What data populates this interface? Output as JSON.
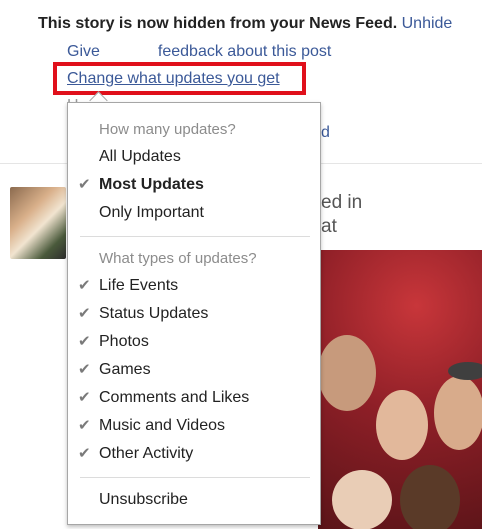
{
  "notice": {
    "hidden_text": "This story is now hidden from your News Feed.",
    "unhide_label": "Unhide",
    "give_label": "Give",
    "feedback_label": "feedback about this post",
    "change_updates_label": "Change what updates you get",
    "partial_text_1": "H",
    "partial_text_2": "d"
  },
  "story": {
    "partial_line_1": "ed in",
    "partial_line_2": "at"
  },
  "menu": {
    "header_how_many": "How many updates?",
    "frequency_options": [
      {
        "label": "All Updates",
        "checked": false
      },
      {
        "label": "Most Updates",
        "checked": true
      },
      {
        "label": "Only Important",
        "checked": false
      }
    ],
    "header_types": "What types of updates?",
    "type_options": [
      {
        "label": "Life Events",
        "checked": true
      },
      {
        "label": "Status Updates",
        "checked": true
      },
      {
        "label": "Photos",
        "checked": true
      },
      {
        "label": "Games",
        "checked": true
      },
      {
        "label": "Comments and Likes",
        "checked": true
      },
      {
        "label": "Music and Videos",
        "checked": true
      },
      {
        "label": "Other Activity",
        "checked": true
      }
    ],
    "unsubscribe_label": "Unsubscribe",
    "check_glyph": "✔"
  },
  "colors": {
    "link": "#3b5998",
    "highlight": "#e0101b"
  }
}
